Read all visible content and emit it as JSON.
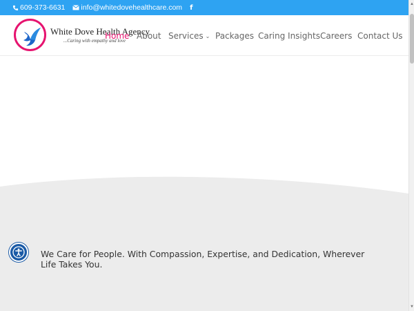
{
  "topbar": {
    "phone": "609-373-6631",
    "email": "info@whitedovehealthcare.com",
    "facebook_icon": "f",
    "background": "#2ea3f2"
  },
  "header": {
    "brand_name": "White Dove Health Agency",
    "tagline": "...Caring with empathy and love",
    "logo_icon": "dove-icon",
    "accent": "#e6136f"
  },
  "nav": {
    "items": [
      {
        "label": "Home",
        "active": true
      },
      {
        "label": "About"
      },
      {
        "label": "Services",
        "dropdown": true
      },
      {
        "label": "Packages"
      },
      {
        "label": "Caring Insights"
      },
      {
        "label": "Careers"
      },
      {
        "label": "Contact Us"
      }
    ]
  },
  "hero": {
    "text": "We Care for People. With Compassion, Expertise, and Dedication, Wherever Life Takes You."
  },
  "accessibility": {
    "icon": "accessibility-icon"
  }
}
